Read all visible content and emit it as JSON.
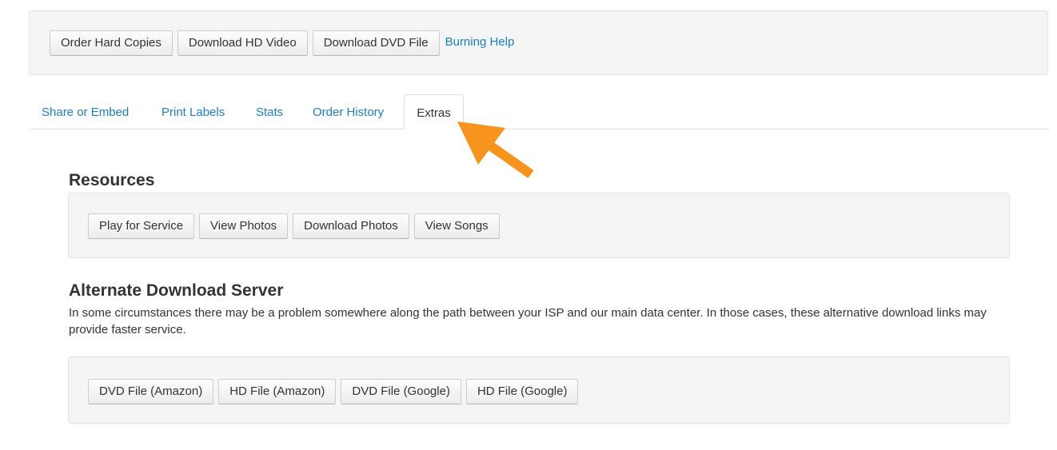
{
  "top_toolbar": {
    "buttons": [
      "Order Hard Copies",
      "Download HD Video",
      "Download DVD File"
    ],
    "help_link": "Burning Help"
  },
  "tabs": [
    {
      "label": "Share or Embed",
      "active": false
    },
    {
      "label": "Print Labels",
      "active": false
    },
    {
      "label": "Stats",
      "active": false
    },
    {
      "label": "Order History",
      "active": false
    },
    {
      "label": "Extras",
      "active": true
    }
  ],
  "resources": {
    "heading": "Resources",
    "buttons": [
      "Play for Service",
      "View Photos",
      "Download Photos",
      "View Songs"
    ]
  },
  "alternate_server": {
    "heading": "Alternate Download Server",
    "description": "In some circumstances there may be a problem somewhere along the path between your ISP and our main data center. In those cases, these alternative download links may provide faster service.",
    "buttons": [
      "DVD File (Amazon)",
      "HD File (Amazon)",
      "DVD File (Google)",
      "HD File (Google)"
    ]
  },
  "colors": {
    "link": "#1a7fc1",
    "annotation_arrow": "#f7941d",
    "well_background": "#f5f5f5"
  },
  "icons": {
    "annotation": "arrow-pointing-up-left-icon"
  }
}
